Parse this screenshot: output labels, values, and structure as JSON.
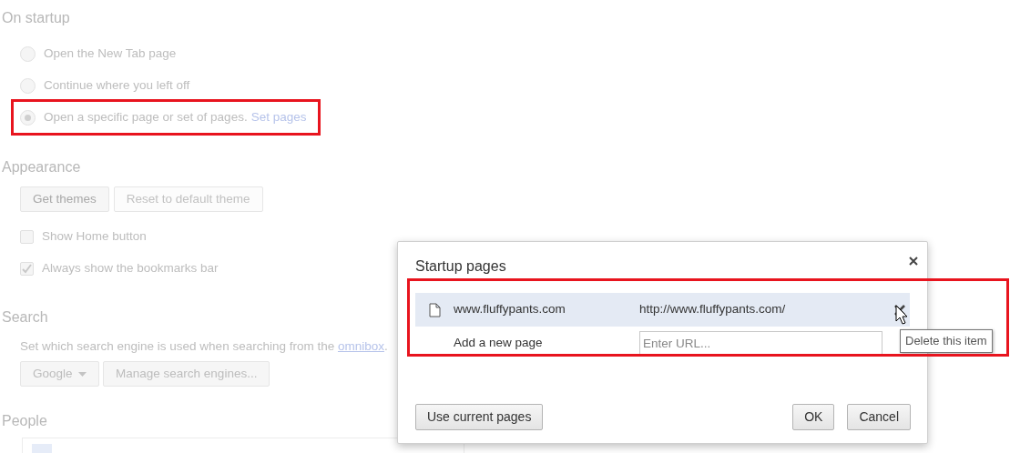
{
  "on_startup": {
    "heading": "On startup",
    "options": [
      {
        "label": "Open the New Tab page",
        "selected": false
      },
      {
        "label": "Continue where you left off",
        "selected": false
      },
      {
        "label": "Open a specific page or set of pages.",
        "link": "Set pages",
        "selected": true
      }
    ]
  },
  "appearance": {
    "heading": "Appearance",
    "buttons": [
      {
        "label": "Get themes",
        "disabled": false
      },
      {
        "label": "Reset to default theme",
        "disabled": true
      }
    ],
    "checkboxes": [
      {
        "label": "Show Home button",
        "checked": false
      },
      {
        "label": "Always show the bookmarks bar",
        "checked": true
      }
    ]
  },
  "search": {
    "heading": "Search",
    "description": "Set which search engine is used when searching from the ",
    "link": "omnibox",
    "after": ".",
    "engine": "Google",
    "manage_button": "Manage search engines..."
  },
  "people": {
    "heading": "People"
  },
  "dialog": {
    "title": "Startup pages",
    "pages": [
      {
        "name": "www.fluffypants.com",
        "url": "http://www.fluffypants.com/",
        "selected": true
      }
    ],
    "new_page": {
      "label": "Add a new page",
      "placeholder": "Enter URL..."
    },
    "tooltip": "Delete this item",
    "buttons": [
      {
        "label": "Use current pages",
        "kind": "left"
      },
      {
        "label": "OK",
        "kind": "right"
      },
      {
        "label": "Cancel",
        "kind": "right"
      }
    ]
  }
}
